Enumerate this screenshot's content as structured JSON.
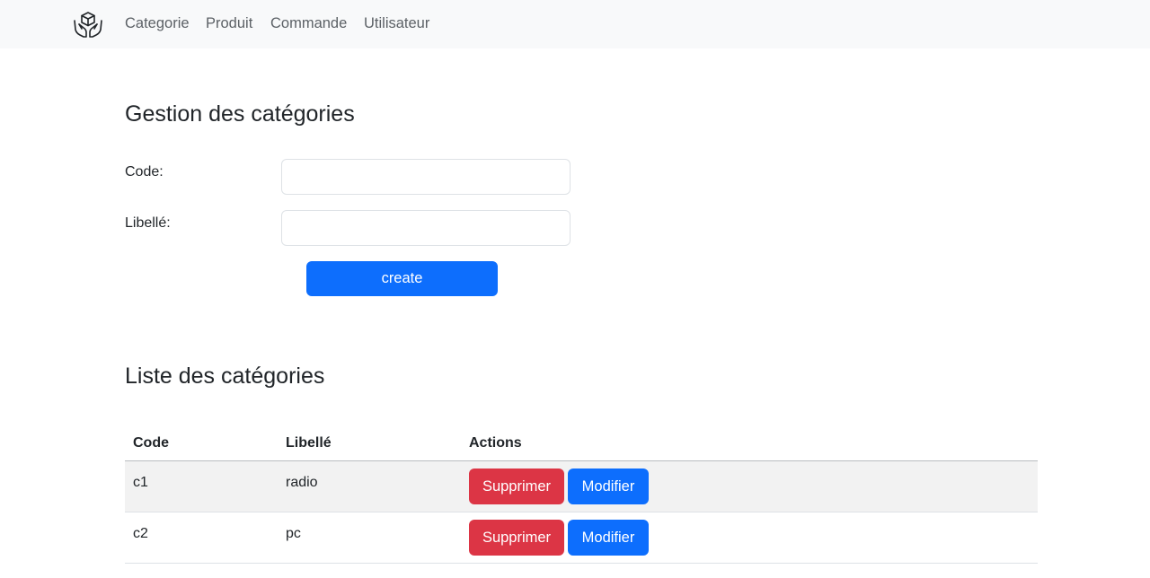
{
  "navbar": {
    "brand_icon": "hands-box-icon",
    "links": [
      "Categorie",
      "Produit",
      "Commande",
      "Utilisateur"
    ]
  },
  "form_section": {
    "title": "Gestion des catégories",
    "code_label": "Code:",
    "code_value": "",
    "libelle_label": "Libellé:",
    "libelle_value": "",
    "create_label": "create"
  },
  "list_section": {
    "title": "Liste des catégories",
    "columns": [
      "Code",
      "Libellé",
      "Actions"
    ],
    "rows": [
      {
        "code": "c1",
        "libelle": "radio",
        "delete_label": "Supprimer",
        "edit_label": "Modifier"
      },
      {
        "code": "c2",
        "libelle": "pc",
        "delete_label": "Supprimer",
        "edit_label": "Modifier"
      }
    ]
  },
  "colors": {
    "primary": "#0d6efd",
    "danger": "#dc3545",
    "navbar_bg": "#f8f9fa",
    "stripe": "#f2f2f2"
  }
}
